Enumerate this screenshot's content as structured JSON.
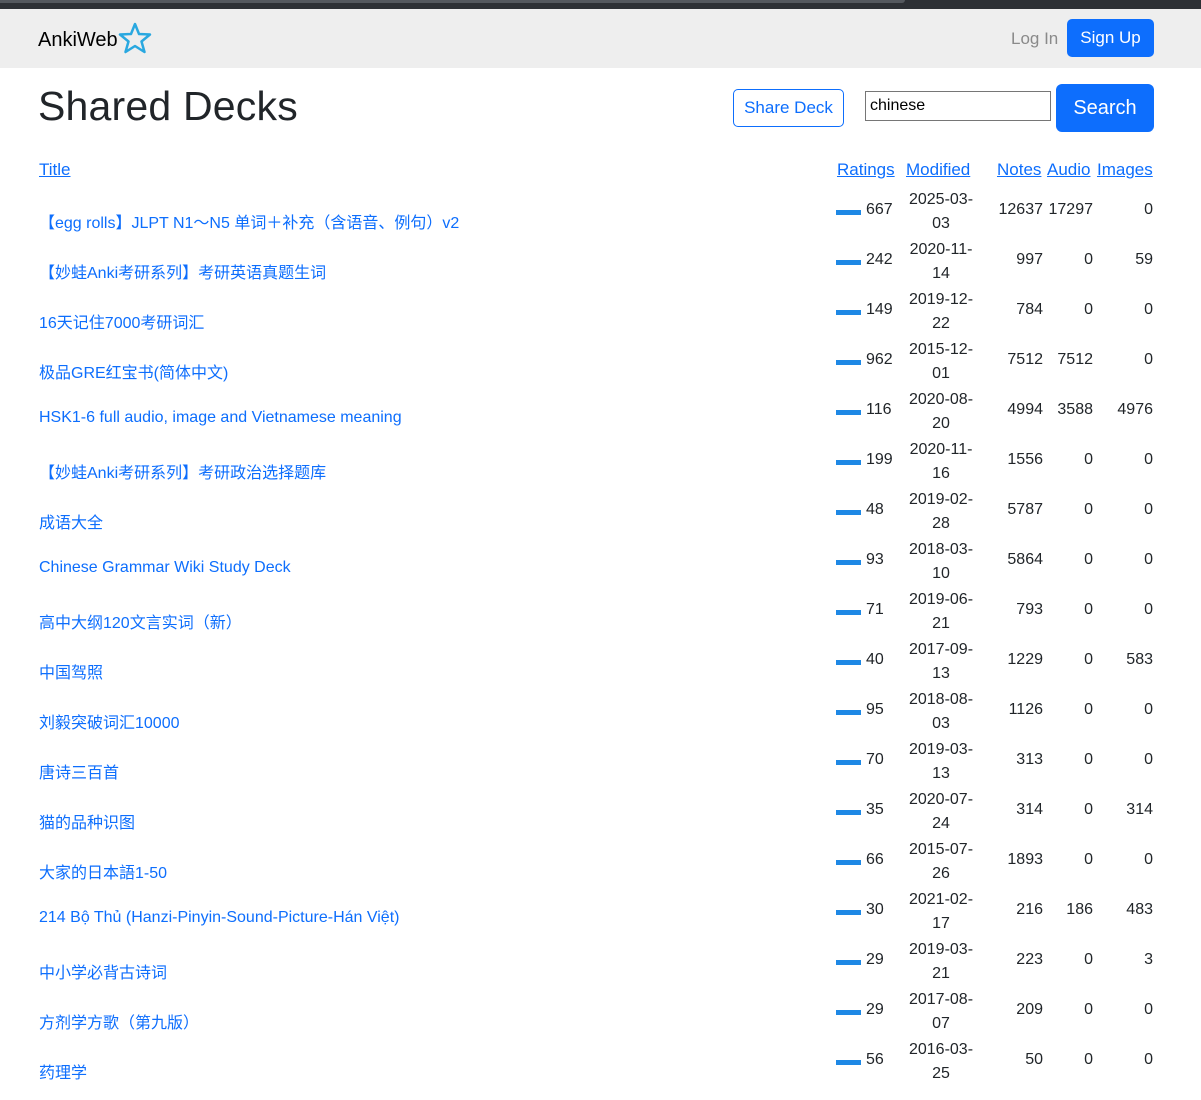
{
  "navbar": {
    "brand": "AnkiWeb",
    "login": "Log In",
    "signup": "Sign Up"
  },
  "page": {
    "title": "Shared Decks",
    "share_button": "Share Deck",
    "search_value": "chinese",
    "search_button": "Search"
  },
  "table": {
    "headers": {
      "title": "Title",
      "ratings": "Ratings",
      "modified": "Modified",
      "notes": "Notes",
      "audio": "Audio",
      "images": "Images"
    },
    "rows": [
      {
        "title": "【egg rolls】JLPT N1～N5 单词＋补充（含语音、例句）v2",
        "ratings": "667",
        "modified_1": "2025-03-",
        "modified_2": "03",
        "notes": "12637",
        "audio": "17297",
        "images": "0"
      },
      {
        "title": "【妙蛙Anki考研系列】考研英语真题生词",
        "ratings": "242",
        "modified_1": "2020-11-",
        "modified_2": "14",
        "notes": "997",
        "audio": "0",
        "images": "59"
      },
      {
        "title": "16天记住7000考研词汇",
        "ratings": "149",
        "modified_1": "2019-12-",
        "modified_2": "22",
        "notes": "784",
        "audio": "0",
        "images": "0"
      },
      {
        "title": "极品GRE红宝书(简体中文)",
        "ratings": "962",
        "modified_1": "2015-12-",
        "modified_2": "01",
        "notes": "7512",
        "audio": "7512",
        "images": "0"
      },
      {
        "title": "HSK1-6 full audio, image and Vietnamese meaning",
        "ratings": "116",
        "modified_1": "2020-08-",
        "modified_2": "20",
        "notes": "4994",
        "audio": "3588",
        "images": "4976"
      },
      {
        "title": "【妙蛙Anki考研系列】考研政治选择题库",
        "ratings": "199",
        "modified_1": "2020-11-",
        "modified_2": "16",
        "notes": "1556",
        "audio": "0",
        "images": "0"
      },
      {
        "title": "成语大全",
        "ratings": "48",
        "modified_1": "2019-02-",
        "modified_2": "28",
        "notes": "5787",
        "audio": "0",
        "images": "0"
      },
      {
        "title": "Chinese Grammar Wiki Study Deck",
        "ratings": "93",
        "modified_1": "2018-03-",
        "modified_2": "10",
        "notes": "5864",
        "audio": "0",
        "images": "0"
      },
      {
        "title": "高中大纲120文言实词（新）",
        "ratings": "71",
        "modified_1": "2019-06-",
        "modified_2": "21",
        "notes": "793",
        "audio": "0",
        "images": "0"
      },
      {
        "title": "中国驾照",
        "ratings": "40",
        "modified_1": "2017-09-",
        "modified_2": "13",
        "notes": "1229",
        "audio": "0",
        "images": "583"
      },
      {
        "title": "刘毅突破词汇10000",
        "ratings": "95",
        "modified_1": "2018-08-",
        "modified_2": "03",
        "notes": "1126",
        "audio": "0",
        "images": "0"
      },
      {
        "title": "唐诗三百首",
        "ratings": "70",
        "modified_1": "2019-03-",
        "modified_2": "13",
        "notes": "313",
        "audio": "0",
        "images": "0"
      },
      {
        "title": "猫的品种识图",
        "ratings": "35",
        "modified_1": "2020-07-",
        "modified_2": "24",
        "notes": "314",
        "audio": "0",
        "images": "314"
      },
      {
        "title": "大家的日本語1-50",
        "ratings": "66",
        "modified_1": "2015-07-",
        "modified_2": "26",
        "notes": "1893",
        "audio": "0",
        "images": "0"
      },
      {
        "title": "214 Bộ Thủ (Hanzi-Pinyin-Sound-Picture-Hán Việt)",
        "ratings": "30",
        "modified_1": "2021-02-",
        "modified_2": "17",
        "notes": "216",
        "audio": "186",
        "images": "483"
      },
      {
        "title": "中小学必背古诗词",
        "ratings": "29",
        "modified_1": "2019-03-",
        "modified_2": "21",
        "notes": "223",
        "audio": "0",
        "images": "3"
      },
      {
        "title": "方剂学方歌（第九版）",
        "ratings": "29",
        "modified_1": "2017-08-",
        "modified_2": "07",
        "notes": "209",
        "audio": "0",
        "images": "0"
      },
      {
        "title": "药理学",
        "ratings": "56",
        "modified_1": "2016-03-",
        "modified_2": "25",
        "notes": "50",
        "audio": "0",
        "images": "0"
      }
    ]
  },
  "colors": {
    "accent": "#0d6efd",
    "rating_bar": "#1e88e5",
    "navbar_bg": "#eeeeee",
    "brand_star": "#29a8e0"
  },
  "icons": {
    "brand": "star-outline-icon"
  }
}
